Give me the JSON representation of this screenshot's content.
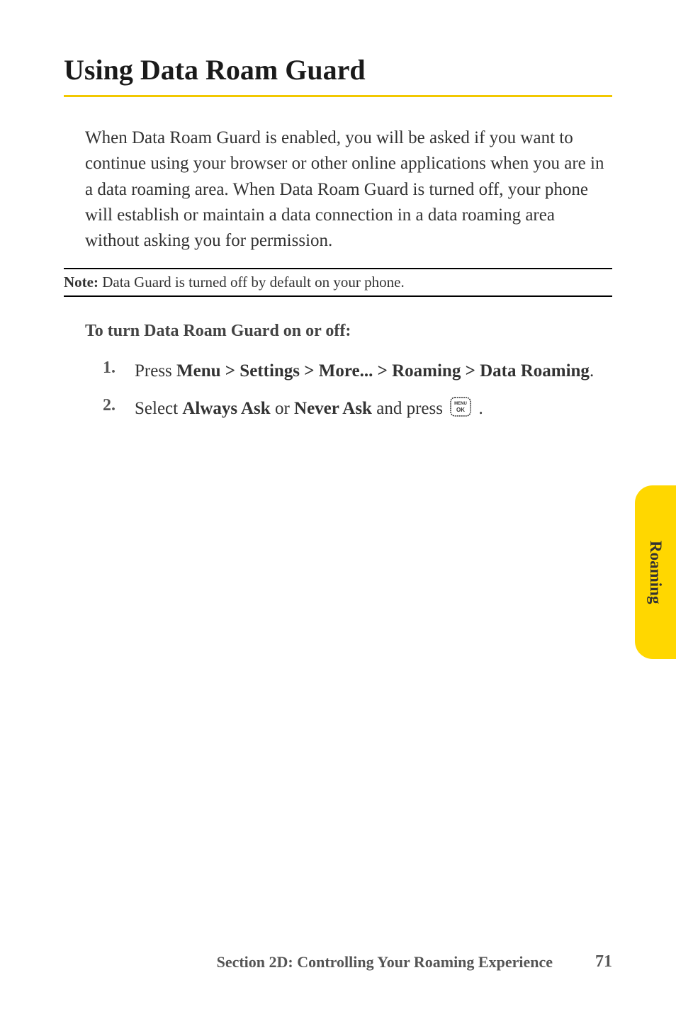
{
  "heading": "Using Data Roam Guard",
  "body": "When Data Roam Guard is enabled, you will be asked if you want to continue using your browser or other online applications when you are in a data roaming area. When Data Roam Guard is turned off, your phone will establish or maintain a data connection in a data roaming area without asking you for permission.",
  "note": {
    "label": "Note:",
    "text": " Data Guard is turned off by default on your phone."
  },
  "sub_heading": "To turn Data Roam Guard on or off:",
  "steps": [
    {
      "num": "1.",
      "pre": "Press ",
      "bold": "Menu > Settings > More... > Roaming > Data Roaming",
      "post": "."
    },
    {
      "num": "2.",
      "pre": "Select ",
      "bold1": "Always Ask",
      "mid": " or ",
      "bold2": "Never Ask",
      "post": " and press ",
      "end": " ."
    }
  ],
  "side_tab": "Roaming",
  "footer": {
    "section": "Section 2D: Controlling Your Roaming Experience",
    "page": "71"
  }
}
